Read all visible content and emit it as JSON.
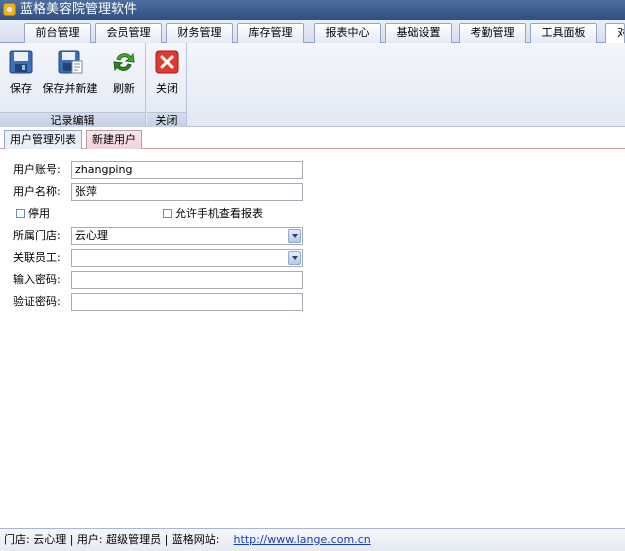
{
  "window": {
    "title": "蓝格美容院管理软件"
  },
  "main_tabs": [
    "前台管理",
    "会员管理",
    "财务管理",
    "库存管理",
    "报表中心",
    "基础设置",
    "考勤管理",
    "工具面板",
    "对"
  ],
  "ribbon": {
    "group_record_edit": {
      "label": "记录编辑",
      "save": "保存",
      "save_new": "保存并新建",
      "refresh": "刷新"
    },
    "group_close": {
      "label": "关闭",
      "close": "关闭"
    }
  },
  "inner_tabs": [
    "用户管理列表",
    "新建用户"
  ],
  "form": {
    "account_label": "用户账号:",
    "account_value": "zhangping",
    "name_label": "用户名称:",
    "name_value": "张萍",
    "disabled_label": "停用",
    "allow_mobile_label": "允许手机查看报表",
    "store_label": "所属门店:",
    "store_value": "云心理",
    "employee_label": "关联员工:",
    "employee_value": "",
    "password_label": "输入密码:",
    "confirm_label": "验证密码:"
  },
  "status": {
    "store": "门店: 云心理",
    "user": "用户: 超级管理员",
    "site_label": "蓝格网站:",
    "site_url": "http://www.lange.com.cn"
  },
  "icons": {
    "save": "save-icon",
    "save_new": "save-new-icon",
    "refresh": "refresh-icon",
    "close": "close-icon"
  },
  "colors": {
    "titlebar": "#3b5b8d",
    "close_red": "#e03a2f",
    "refresh_green": "#3e9a2c",
    "link": "#1a3bbf"
  }
}
